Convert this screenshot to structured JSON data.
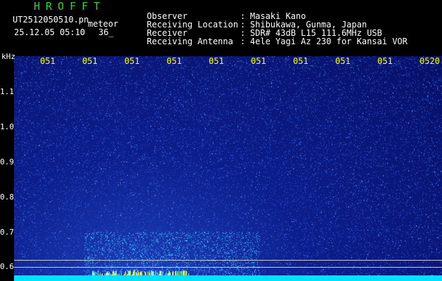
{
  "header": {
    "program_name": "HROFFT",
    "file_name": "UT2512050510.pn",
    "mode": "meteor",
    "datetime": "25.12.05 05:10",
    "count": "36_",
    "rows": [
      {
        "label": "Observer",
        "value": "Masaki Kano"
      },
      {
        "label": "Receiving Location",
        "value": "Shibukawa, Gunma, Japan"
      },
      {
        "label": "Receiver",
        "value": "SDR# 43dB L15 111.6MHz USB"
      },
      {
        "label": "Receiving Antenna",
        "value": "4ele Yagi Az 230 for Kansai VOR"
      }
    ]
  },
  "y_axis": {
    "unit": "kHz",
    "ticks": [
      "1.1",
      "1.0",
      "0.9",
      "0.8",
      "0.7",
      "0.6"
    ]
  },
  "time_axis": {
    "ticks": [
      "051",
      "051",
      "051",
      "051",
      "051",
      "051",
      "051",
      "051",
      "051",
      "0520"
    ]
  },
  "colors": {
    "background": "#000000",
    "program_name": "#22dd22",
    "header_text": "#ffffff",
    "time_labels": "#ffff00",
    "noise_dark": "#071066",
    "noise_mid": "#1b3fb8",
    "cyan_band": "#00e0ff",
    "guide_line": "#c8c8c8"
  }
}
